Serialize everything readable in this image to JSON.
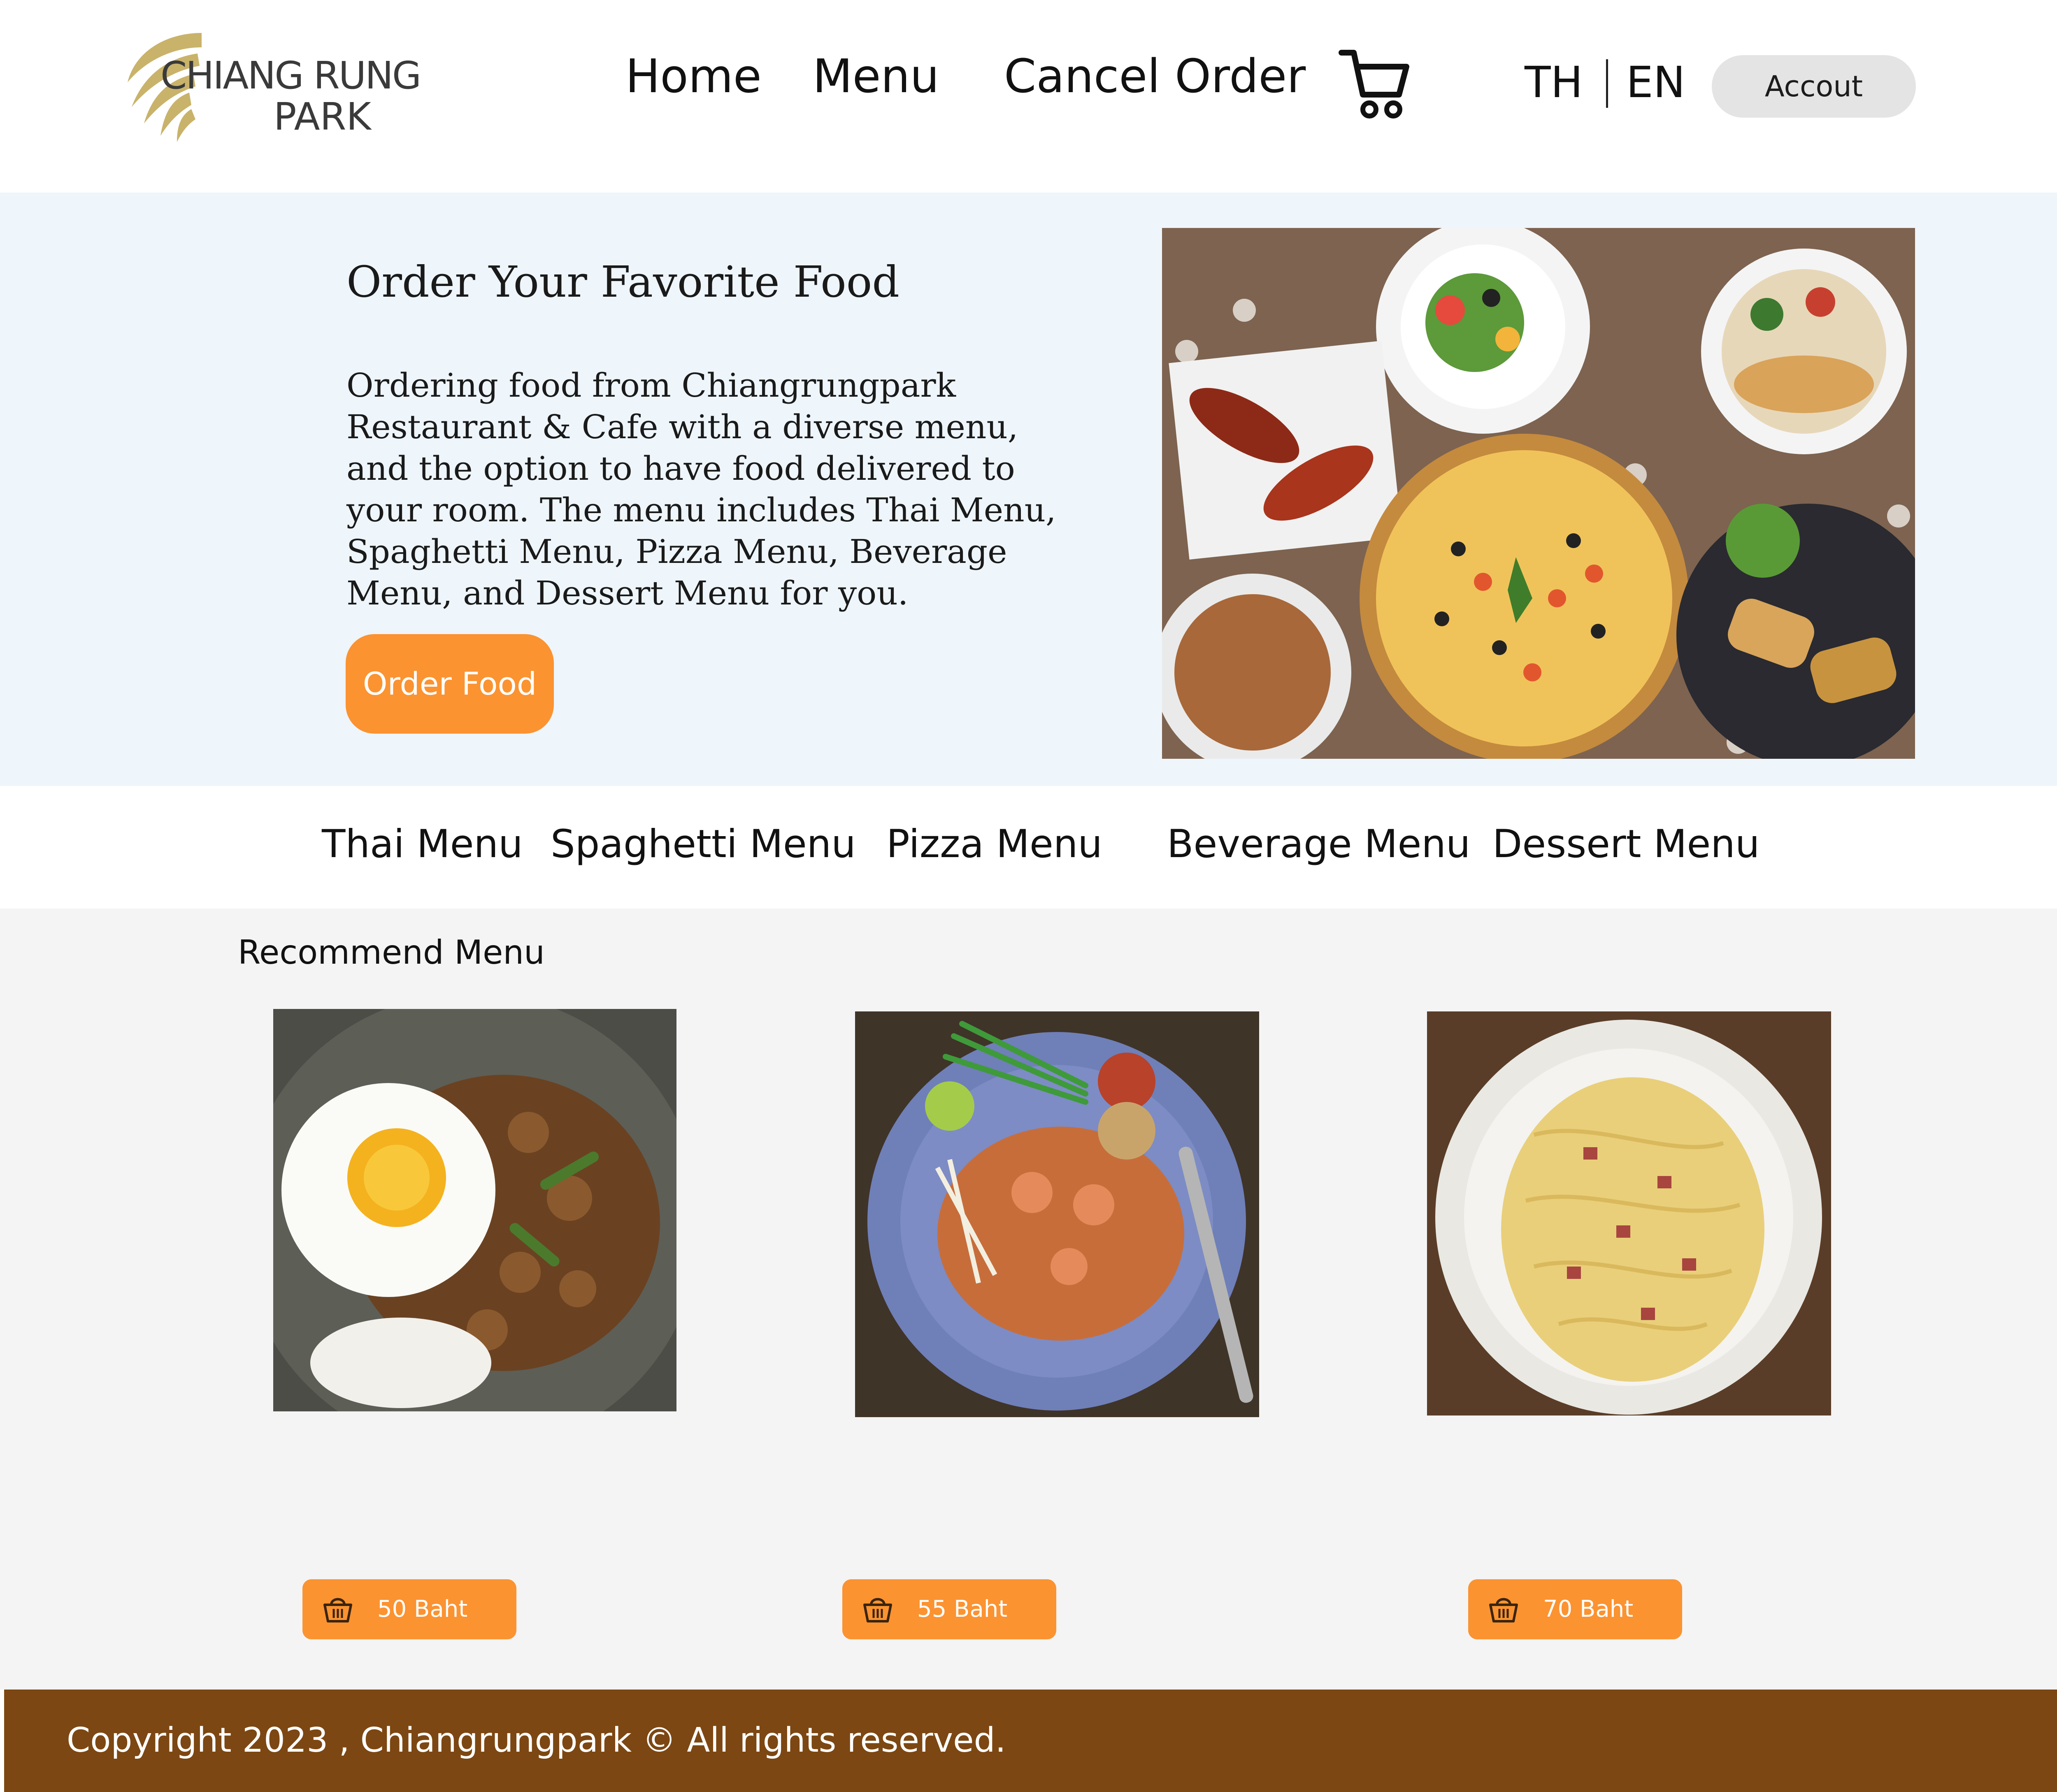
{
  "header": {
    "logo": {
      "line1": "CHIANG RUNG",
      "line2": "PARK",
      "accent_color": "#c9b36a"
    },
    "nav": [
      "Home",
      "Menu",
      "Cancel Order"
    ],
    "cart_icon": "cart-icon",
    "languages": [
      "TH",
      "EN"
    ],
    "account_label": "Accout"
  },
  "hero": {
    "title": "Order Your Favorite Food",
    "body": "Ordering food from Chiangrungpark Restaurant & Cafe with a diverse menu, and the option to have food delivered to your room. The menu includes Thai Menu, Spaghetti Menu, Pizza Menu, Beverage Menu, and Dessert Menu for you.",
    "button_label": "Order Food",
    "button_color": "#fb9331",
    "background": "#eef5fb"
  },
  "categories": [
    "Thai Menu",
    "Spaghetti Menu",
    "Pizza Menu",
    "Beverage Menu",
    "Dessert Menu"
  ],
  "recommend": {
    "title": "Recommend Menu",
    "items": [
      {
        "image": "basil-chicken-rice-with-fried-egg",
        "price": "50 Baht"
      },
      {
        "image": "pad-thai-shrimp",
        "price": "55 Baht"
      },
      {
        "image": "spaghetti-carbonara",
        "price": "70 Baht"
      }
    ],
    "basket_icon": "basket-icon"
  },
  "footer": {
    "text": "Copyright 2023 , Chiangrungpark © All rights reserved.",
    "background": "#7c4712"
  }
}
